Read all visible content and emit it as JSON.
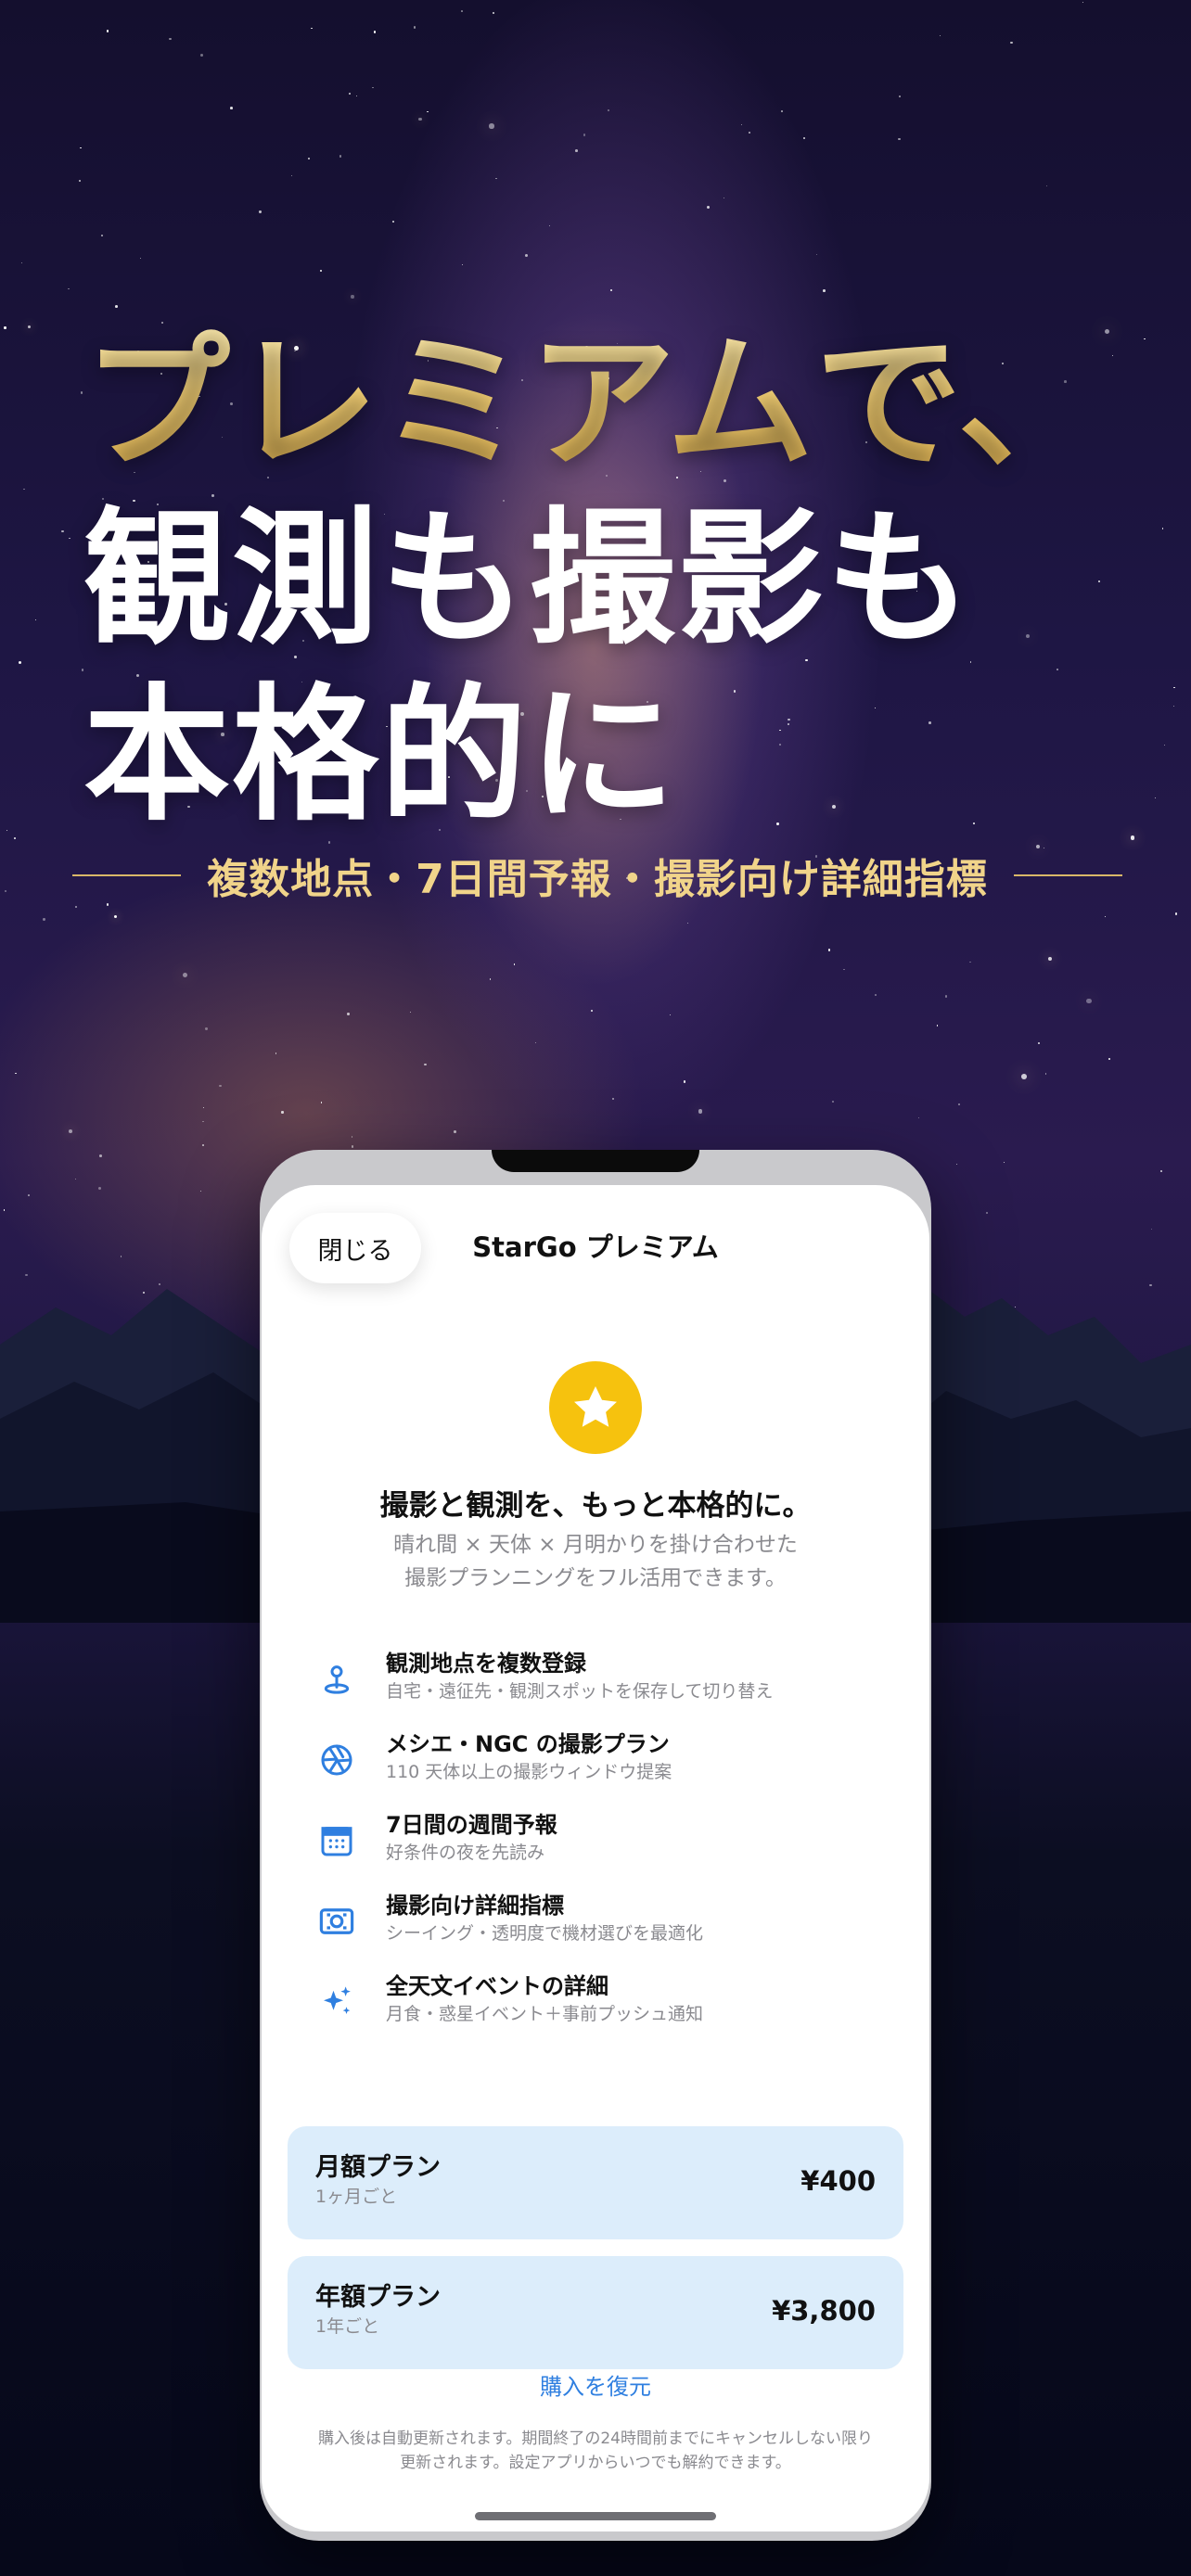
{
  "headline": {
    "line1": "プレミアムで、",
    "line2": "観測も撮影も",
    "line3": "本格的に",
    "subline": "複数地点・7日間予報・撮影向け詳細指標"
  },
  "screen": {
    "close_label": "閉じる",
    "title": "StarGo プレミアム",
    "hero_icon": "star-icon",
    "hero_title": "撮影と観測を、もっと本格的に。",
    "hero_sub_line1": "晴れ間 × 天体 × 月明かりを掛け合わせた",
    "hero_sub_line2": "撮影プランニングをフル活用できます。",
    "features": [
      {
        "icon": "location-pin-icon",
        "title": "観測地点を複数登録",
        "desc": "自宅・遠征先・観測スポットを保存して切り替え"
      },
      {
        "icon": "aperture-icon",
        "title": "メシエ・NGC の撮影プラン",
        "desc": "110 天体以上の撮影ウィンドウ提案"
      },
      {
        "icon": "calendar-icon",
        "title": "7日間の週間予報",
        "desc": "好条件の夜を先読み"
      },
      {
        "icon": "viewfinder-icon",
        "title": "撮影向け詳細指標",
        "desc": "シーイング・透明度で機材選びを最適化"
      },
      {
        "icon": "sparkles-icon",
        "title": "全天文イベントの詳細",
        "desc": "月食・惑星イベント＋事前プッシュ通知"
      }
    ],
    "plans": [
      {
        "name": "月額プラン",
        "period": "1ヶ月ごと",
        "price": "¥400"
      },
      {
        "name": "年額プラン",
        "period": "1年ごと",
        "price": "¥3,800"
      }
    ],
    "restore_label": "購入を復元",
    "legal_line1": "購入後は自動更新されます。期間終了の24時間前までにキャンセルしない限り",
    "legal_line2": "更新されます。設定アプリからいつでも解約できます。"
  },
  "colors": {
    "accent_blue": "#2f7fe0",
    "gold": "#f1d48a",
    "star_yellow": "#f6c20e",
    "plan_bg": "#dcedfb"
  }
}
